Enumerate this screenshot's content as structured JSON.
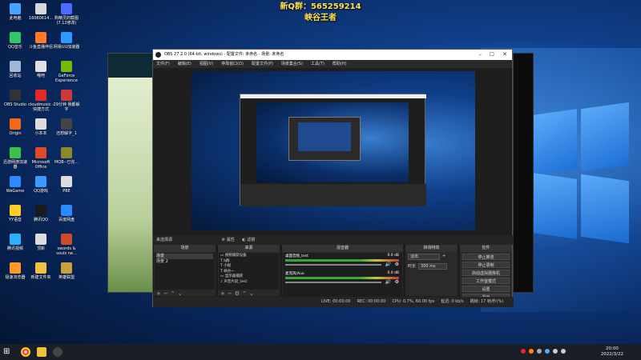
{
  "overlay": {
    "line1": "新Q群：565259214",
    "line2": "峡谷王者"
  },
  "desktop_icons": [
    {
      "label": "此电脑",
      "color": "#4aa3ff"
    },
    {
      "label": "16080614...",
      "color": "#d8d8d8"
    },
    {
      "label": "购精灵的截图 (7.12修改)",
      "color": "#4a6cff"
    },
    {
      "label": "QQ音乐",
      "color": "#2fc86a"
    },
    {
      "label": "斗鱼直播伴侣",
      "color": "#ff7a2a"
    },
    {
      "label": "网易UU加速器",
      "color": "#2b9bff"
    },
    {
      "label": "回收站",
      "color": "#9fb8d8"
    },
    {
      "label": "哦吧",
      "color": "#e0e0e0"
    },
    {
      "label": "GeForce Experience",
      "color": "#76b900"
    },
    {
      "label": "OBS Studio",
      "color": "#333333"
    },
    {
      "label": "cloudmusic - 快捷方式",
      "color": "#e02a2a"
    },
    {
      "label": "29分钟 我都解字",
      "color": "#cc3a3a"
    },
    {
      "label": "Origin",
      "color": "#f06a1a"
    },
    {
      "label": "小本本",
      "color": "#dddddd"
    },
    {
      "label": "还想解字_1",
      "color": "#444444"
    },
    {
      "label": "迅游网游加速器",
      "color": "#3ac24a"
    },
    {
      "label": "Microsoft Office",
      "color": "#e04a2a"
    },
    {
      "label": "MQB--已完...",
      "color": "#8a8a2a"
    },
    {
      "label": "WeGame",
      "color": "#2a8aff"
    },
    {
      "label": "QQ游戏",
      "color": "#3a9aff"
    },
    {
      "label": "PBE",
      "color": "#dddddd"
    },
    {
      "label": "YY语音",
      "color": "#ffcc2a"
    },
    {
      "label": "腾讯QQ",
      "color": "#1a1a1a"
    },
    {
      "label": "百度网盘",
      "color": "#2a8aff"
    },
    {
      "label": "腾讯视频",
      "color": "#2ab0ff"
    },
    {
      "label": "顶新",
      "color": "#dddddd"
    },
    {
      "label": "swords & souls ne...",
      "color": "#cc4a2a"
    },
    {
      "label": "极速浏览器",
      "color": "#ff9a2a"
    },
    {
      "label": "新建文件夹",
      "color": "#f0c040"
    },
    {
      "label": "英雄联盟",
      "color": "#c8a040"
    }
  ],
  "obs": {
    "title": "OBS 27.2.0 (64-bit, windows) - 配置文件: 未命名 - 场景: 未命名",
    "menu": [
      "文件(F)",
      "编辑(E)",
      "视图(V)",
      "停靠窗口(D)",
      "配置文件(P)",
      "场景集合(S)",
      "工具(T)",
      "帮助(H)"
    ],
    "preview_tab": "来选择源",
    "props_btn": "属性",
    "filter_btn": "滤镜",
    "scenes": {
      "header": "场景",
      "items": [
        "场景",
        "场景 2"
      ]
    },
    "sources": {
      "header": "来源",
      "items": [
        "视频捕获设备",
        "b群",
        "小视",
        "峡谷一",
        "显示器捕获",
        "声音片段_test"
      ]
    },
    "mixer": {
      "header": "混音器",
      "channels": [
        {
          "name": "桌面音频_test",
          "db": "0.0 dB"
        },
        {
          "name": "麦克风/Aux",
          "db": "0.0 dB"
        }
      ]
    },
    "transitions": {
      "header": "转场特效",
      "type": "淡出",
      "duration_label": "时长",
      "duration": "300 ms"
    },
    "controls": {
      "header": "控件",
      "buttons": [
        "停止推流",
        "停止录制",
        "启动虚拟摄像机",
        "工作室模式",
        "设置",
        "退出"
      ]
    },
    "status": [
      "LIVE: 00:00:00",
      "REC: 00:00:00",
      "CPU: 0.7%, 60.00 fps",
      "延迟: 0 kb/s",
      "跳帧: 17 帧/秒(%)"
    ]
  },
  "taskbar": {
    "time": "20:00",
    "date": "2022/3/22"
  }
}
